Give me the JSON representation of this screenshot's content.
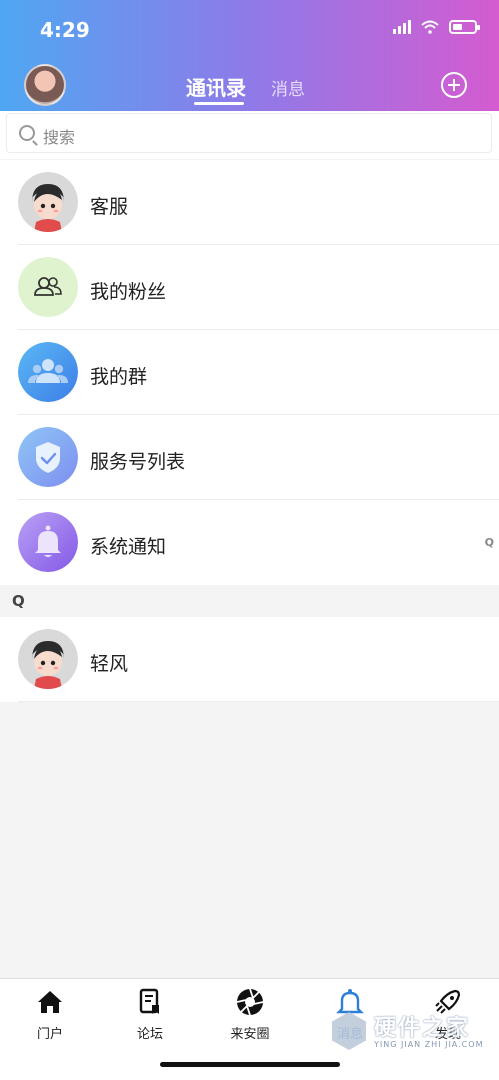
{
  "status_bar": {
    "time": "4:29"
  },
  "header": {
    "tabs": [
      {
        "label": "通讯录",
        "active": true
      },
      {
        "label": "消息",
        "active": false
      }
    ]
  },
  "search": {
    "placeholder": "搜索"
  },
  "contacts": [
    {
      "label": "客服",
      "icon": "avatar-cartoon-girl"
    },
    {
      "label": "我的粉丝",
      "icon": "users-outline-icon"
    },
    {
      "label": "我的群",
      "icon": "group-icon"
    },
    {
      "label": "服务号列表",
      "icon": "shield-check-icon"
    },
    {
      "label": "系统通知",
      "icon": "bell-icon",
      "index_hint": "Q"
    }
  ],
  "section": {
    "letter": "Q"
  },
  "friends": [
    {
      "label": "轻风",
      "icon": "avatar-cartoon-girl"
    }
  ],
  "bottom_nav": [
    {
      "label": "门户",
      "icon": "home-icon"
    },
    {
      "label": "论坛",
      "icon": "forum-icon"
    },
    {
      "label": "来安圈",
      "icon": "aperture-icon"
    },
    {
      "label": "消息",
      "icon": "bell-icon",
      "active": true
    },
    {
      "label": "发现",
      "icon": "rocket-icon"
    }
  ],
  "watermark": {
    "title": "硬件之家",
    "subtitle": "YING JIAN ZHI JIA.COM"
  },
  "colors": {
    "header_start": "#4fa7f2",
    "header_end": "#d45bd0",
    "active_nav": "#2e7fd8"
  }
}
